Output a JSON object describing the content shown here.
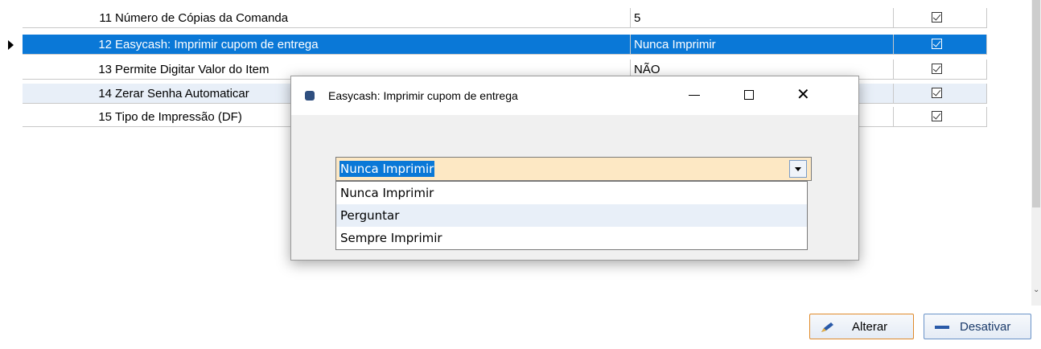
{
  "grid": {
    "rows": [
      {
        "num": "11",
        "desc": "Número de Cópias da Comanda",
        "value": "5",
        "checked": true
      },
      {
        "num": "12",
        "desc": "Easycash: Imprimir cupom de entrega",
        "value": "Nunca Imprimir",
        "checked": true
      },
      {
        "num": "13",
        "desc": "Permite Digitar Valor do Item",
        "value": "NÃO",
        "checked": true
      },
      {
        "num": "14",
        "desc": "Zerar Senha Automaticar",
        "value": "",
        "checked": true
      },
      {
        "num": "15",
        "desc": "Tipo de Impressão (DF)",
        "value": "",
        "checked": true
      }
    ]
  },
  "dialog": {
    "title": "Easycash: Imprimir cupom de entrega",
    "combo_value": "Nunca Imprimir",
    "options": [
      "Nunca Imprimir",
      "Perguntar",
      "Sempre Imprimir"
    ]
  },
  "buttons": {
    "alterar": "Alterar",
    "desativar": "Desativar"
  },
  "colors": {
    "selection": "#0a78d7",
    "combo_bg": "#fde8c4",
    "alt_row": "#e8eff8"
  }
}
